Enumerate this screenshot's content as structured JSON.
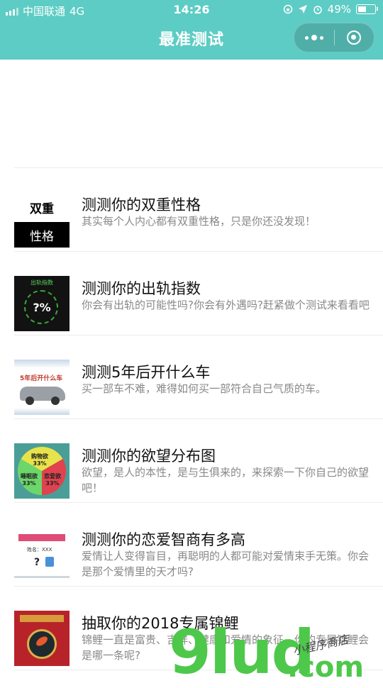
{
  "status_bar": {
    "carrier": "中国联通",
    "network": "4G",
    "time": "14:26",
    "battery": "49%",
    "battery_level": 0.49
  },
  "nav": {
    "title": "最准测试",
    "menu_icon": "more-dots-icon",
    "close_icon": "target-close-icon"
  },
  "items": [
    {
      "title": "测测你的双重性格",
      "desc": "其实每个人内心都有双重性格，只是你还没发现！",
      "thumb": {
        "top": "双重",
        "bottom": "性格"
      }
    },
    {
      "title": "测测你的出轨指数",
      "desc": "你会有出轨的可能性吗?你会有外遇吗?赶紧做个测试来看看吧",
      "thumb": {
        "label": "出轨指数",
        "value": "?%"
      }
    },
    {
      "title": "测测5年后开什么车",
      "desc": "买一部车不难，难得如何买一部符合自己气质的车。",
      "thumb": {
        "label": "5年后开什么车"
      }
    },
    {
      "title": "测测你的欲望分布图",
      "desc": "欲望，是人的本性，是与生俱来的，来探索一下你自己的欲望吧！",
      "thumb": {
        "a": "购物欲",
        "a_pct": "33%",
        "b": "睡眠欲",
        "b_pct": "33%",
        "c": "恋爱欲",
        "c_pct": "33%"
      }
    },
    {
      "title": "测测你的恋爱智商有多高",
      "desc": "爱情让人变得盲目，再聪明的人都可能对爱情束手无策。你会是那个爱情里的天才吗?",
      "thumb": {
        "name": "姓名：XXX",
        "q": "?"
      }
    },
    {
      "title": "抽取你的2018专属锦鲤",
      "desc": "锦鲤一直是富贵、吉祥、健康和爱情的象征，你的专属锦鲤会是哪一条呢?"
    }
  ],
  "watermark": {
    "main": "9lud",
    "dot": ".com",
    "note": "小程序商店"
  }
}
